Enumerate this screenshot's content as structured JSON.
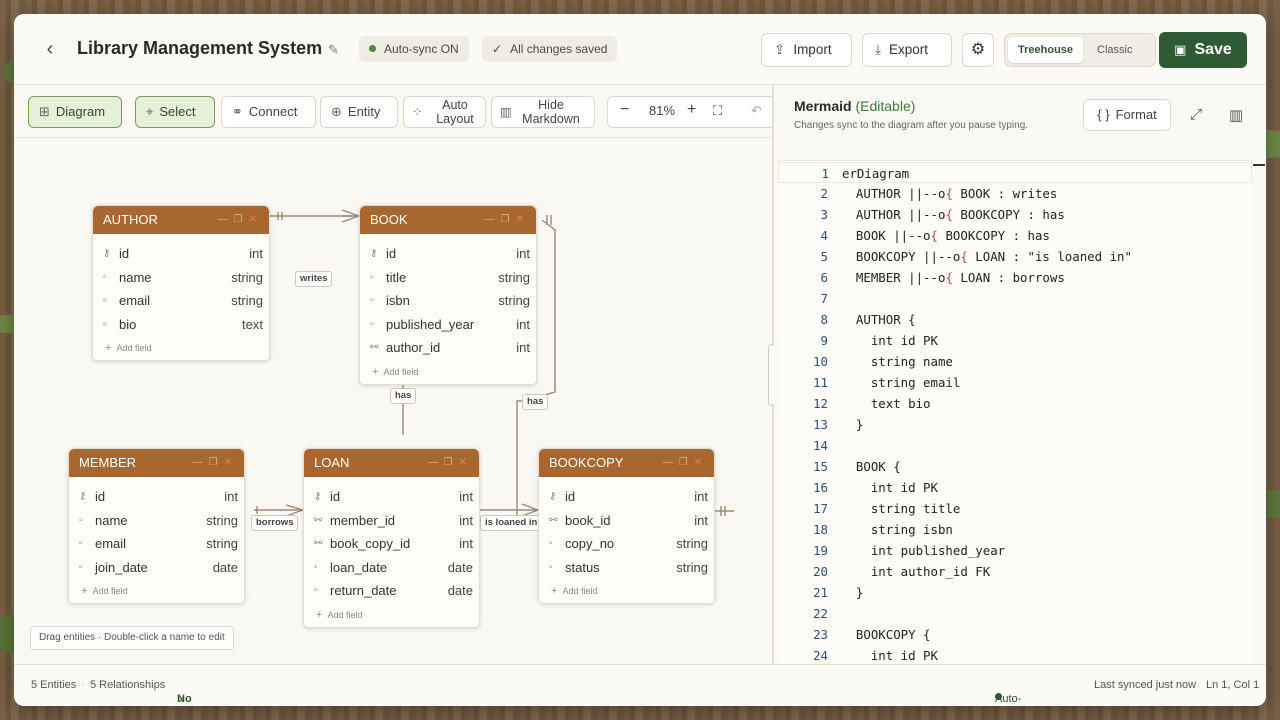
{
  "header": {
    "title": "Library Management System",
    "autosync_label": "Auto-sync ON",
    "saved_label": "All changes saved",
    "import_label": "Import",
    "export_label": "Export",
    "theme_options": [
      "Treehouse",
      "Classic"
    ],
    "theme_selected": "Treehouse",
    "save_label": "Save",
    "accent_color": "#2f5b34"
  },
  "toolbar": {
    "diagram": "Diagram",
    "select": "Select",
    "connect": "Connect",
    "entity": "Entity",
    "auto_layout": "Auto Layout",
    "hide_markdown": "Hide Markdown",
    "zoom": "81%"
  },
  "entities": [
    {
      "name": "AUTHOR",
      "fields": [
        [
          "id",
          "int",
          "key"
        ],
        [
          "name",
          "string",
          "col"
        ],
        [
          "email",
          "string",
          "col"
        ],
        [
          "bio",
          "text",
          "col"
        ]
      ]
    },
    {
      "name": "BOOK",
      "fields": [
        [
          "id",
          "int",
          "key"
        ],
        [
          "title",
          "string",
          "col"
        ],
        [
          "isbn",
          "string",
          "col"
        ],
        [
          "published_year",
          "int",
          "col"
        ],
        [
          "author_id",
          "int",
          "fk"
        ]
      ]
    },
    {
      "name": "MEMBER",
      "fields": [
        [
          "id",
          "int",
          "key"
        ],
        [
          "name",
          "string",
          "col"
        ],
        [
          "email",
          "string",
          "col"
        ],
        [
          "join_date",
          "date",
          "col"
        ]
      ]
    },
    {
      "name": "LOAN",
      "fields": [
        [
          "id",
          "int",
          "key"
        ],
        [
          "member_id",
          "int",
          "fk"
        ],
        [
          "book_copy_id",
          "int",
          "fk"
        ],
        [
          "loan_date",
          "date",
          "col"
        ],
        [
          "return_date",
          "date",
          "col"
        ]
      ]
    },
    {
      "name": "BOOKCOPY",
      "fields": [
        [
          "id",
          "int",
          "key"
        ],
        [
          "book_id",
          "int",
          "fk"
        ],
        [
          "copy_no",
          "string",
          "col"
        ],
        [
          "status",
          "string",
          "col"
        ]
      ]
    }
  ],
  "add_field_label": "Add field",
  "relationships": {
    "writes": "writes",
    "has_book_loan": "has",
    "has_book_copy": "has",
    "borrows": "borrows",
    "loaned": "is loaned in"
  },
  "canvas_hint": "Drag entities · Double-click a name to edit",
  "editor": {
    "title": "Mermaid",
    "title_suffix": "(Editable)",
    "subtitle": "Changes sync to the diagram after you pause typing.",
    "format_label": "Format",
    "lines": [
      "erDiagram",
      "  AUTHOR ||--o{ BOOK : writes",
      "  AUTHOR ||--o{ BOOKCOPY : has",
      "  BOOK ||--o{ BOOKCOPY : has",
      "  BOOKCOPY ||--o{ LOAN : \"is loaned in\"",
      "  MEMBER ||--o{ LOAN : borrows",
      "",
      "  AUTHOR {",
      "    int id PK",
      "    string name",
      "    string email",
      "    text bio",
      "  }",
      "",
      "  BOOK {",
      "    int id PK",
      "    string title",
      "    string isbn",
      "    int published_year",
      "    int author_id FK",
      "  }",
      "",
      "  BOOKCOPY {",
      "    int id PK"
    ]
  },
  "status": {
    "entities": "5 Entities",
    "relationships": "5 Relationships",
    "issues": "No issues",
    "autosync": "Auto-sync ON",
    "last_synced": "Last synced just now",
    "cursor": "Ln 1, Col 1"
  }
}
